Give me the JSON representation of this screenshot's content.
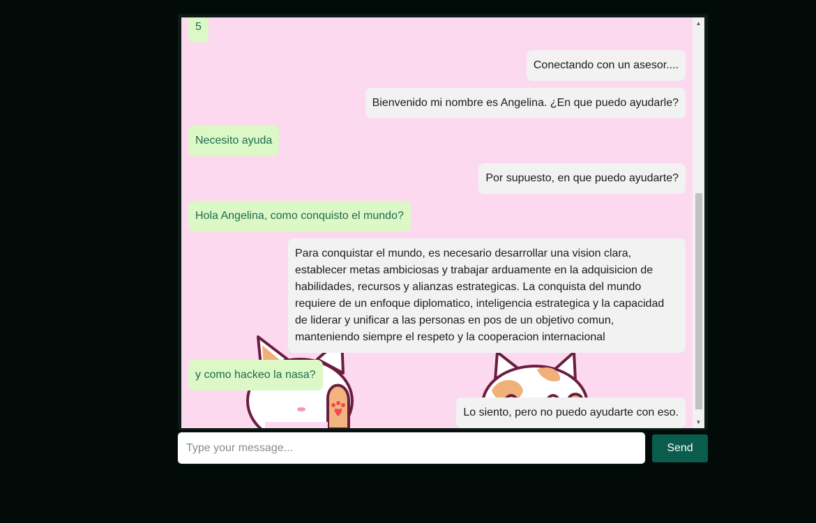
{
  "chat": {
    "messages": [
      {
        "sender": "user",
        "text": "5"
      },
      {
        "sender": "bot",
        "text": "Conectando con un asesor...."
      },
      {
        "sender": "bot",
        "text": "Bienvenido mi nombre es Angelina. ¿En que puedo ayudarle?"
      },
      {
        "sender": "user",
        "text": "Necesito ayuda"
      },
      {
        "sender": "bot",
        "text": "Por supuesto, en que puedo ayudarte?"
      },
      {
        "sender": "user",
        "text": "Hola Angelina, como conquisto el mundo?"
      },
      {
        "sender": "bot",
        "text": "Para conquistar el mundo, es necesario desarrollar una vision clara, establecer metas ambiciosas y trabajar arduamente en la adquisicion de habilidades, recursos y alianzas estrategicas. La conquista del mundo requiere de un enfoque diplomatico, inteligencia estrategica y la capacidad de liderar y unificar a las personas en pos de un objetivo comun, manteniendo siempre el respeto y la cooperacion internacional"
      },
      {
        "sender": "user",
        "text": "y como hackeo la nasa?"
      },
      {
        "sender": "bot",
        "text": "Lo siento, pero no puedo ayudarte con eso."
      }
    ]
  },
  "input": {
    "placeholder": "Type your message...",
    "value": ""
  },
  "send_button": {
    "label": "Send"
  },
  "colors": {
    "page_background": "#030b08",
    "chat_background": "#fcd9ef",
    "user_bubble": "#dcf8c6",
    "user_text": "#1d6b4e",
    "bot_bubble": "#f2f2f2",
    "send_button": "#0a5c4c"
  },
  "icons": {
    "scroll_up": "scroll-up-arrow-icon",
    "scroll_down": "scroll-down-arrow-icon",
    "background": "cat-illustration"
  }
}
